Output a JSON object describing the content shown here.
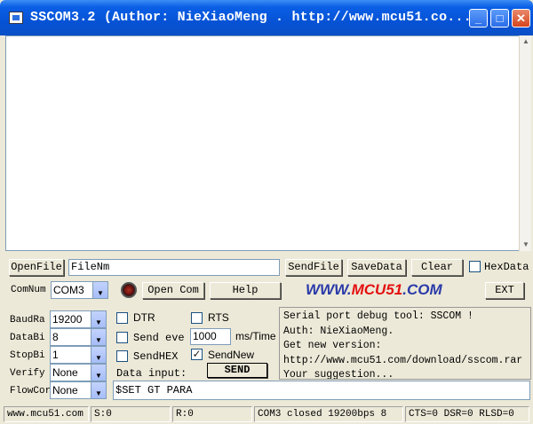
{
  "window": {
    "title": "SSCOM3.2 (Author: NieXiaoMeng .  http://www.mcu51.co...",
    "minimize_glyph": "_",
    "maximize_glyph": "□",
    "close_glyph": "✕"
  },
  "receive": {
    "content": ""
  },
  "file_row": {
    "open_file_label": "OpenFile",
    "file_name_value": "FileNm",
    "send_file_label": "SendFile",
    "save_data_label": "SaveData",
    "clear_label": "Clear",
    "hex_data_label": "HexData",
    "hex_data_checked": false
  },
  "com_row": {
    "com_num_label": "ComNum",
    "com_num_value": "COM3",
    "open_com_label": "Open Com",
    "help_label": "Help",
    "logo_prefix": "WWW.",
    "logo_brand": "MCU51",
    "logo_suffix": ".COM",
    "ext_label": "EXT"
  },
  "serial_settings": [
    {
      "label": "BaudRa",
      "value": "19200"
    },
    {
      "label": "DataBi",
      "value": "8"
    },
    {
      "label": "StopBi",
      "value": "1"
    },
    {
      "label": "Verify",
      "value": "None"
    },
    {
      "label": "FlowCor",
      "value": "None"
    }
  ],
  "options": {
    "dtr_label": "DTR",
    "dtr_checked": false,
    "rts_label": "RTS",
    "rts_checked": false,
    "send_every_label": "Send eve",
    "send_every_checked": false,
    "interval_value": "1000",
    "interval_unit": "ms/Time",
    "send_hex_label": "SendHEX",
    "send_hex_checked": false,
    "send_new_label": "SendNew",
    "send_new_checked": true,
    "data_input_label": "Data input:",
    "send_label": "SEND",
    "send_input_value": "$SET GT PARA"
  },
  "info_text": "Serial port debug tool: SSCOM !\nAuth: NieXiaoMeng.\nGet new version:\nhttp://www.mcu51.com/download/sscom.rar\nYour suggestion...",
  "status_bar": {
    "website": "www.mcu51.com",
    "sent": "S:0",
    "received": "R:0",
    "port_status": "COM3 closed  19200bps  8",
    "signals": "CTS=0 DSR=0 RLSD=0"
  },
  "colors": {
    "titlebar": "#0653d6",
    "logo_blue": "#2a3aa8",
    "logo_red": "#e41010",
    "window_face": "#ece9d8"
  }
}
